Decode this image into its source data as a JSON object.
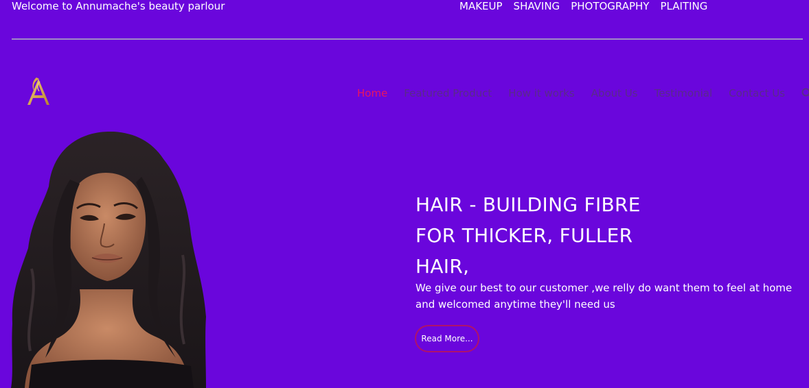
{
  "topbar": {
    "welcome": "Welcome to Annumache's beauty parlour",
    "links": [
      "MAKEUP",
      "SHAVING",
      "PHOTOGRAPHY",
      "PLAITING"
    ]
  },
  "nav": {
    "logo_icon": "annumache-a-logo",
    "items": [
      "Home",
      "Featured Product",
      "How it works",
      "About Us",
      "Testimonial",
      "Contact Us"
    ],
    "active_item": "Home",
    "search_icon": "search-icon"
  },
  "hero": {
    "title_lines": [
      "HAIR - BUILDING FIBRE",
      "FOR THICKER, FULLER",
      "HAIR,"
    ],
    "description": "We give our best to our customer ,we relly do want them to feel at home and welcomed anytime they'll need us",
    "button_label": "Read More...",
    "image": "woman-with-long-wavy-hair-portrait"
  },
  "colors": {
    "background": "#6a06dc",
    "nav_text": "#5a2b8a",
    "nav_active": "#e81560",
    "button_border": "#b0126a",
    "logo_gold": "#d9a54a"
  }
}
